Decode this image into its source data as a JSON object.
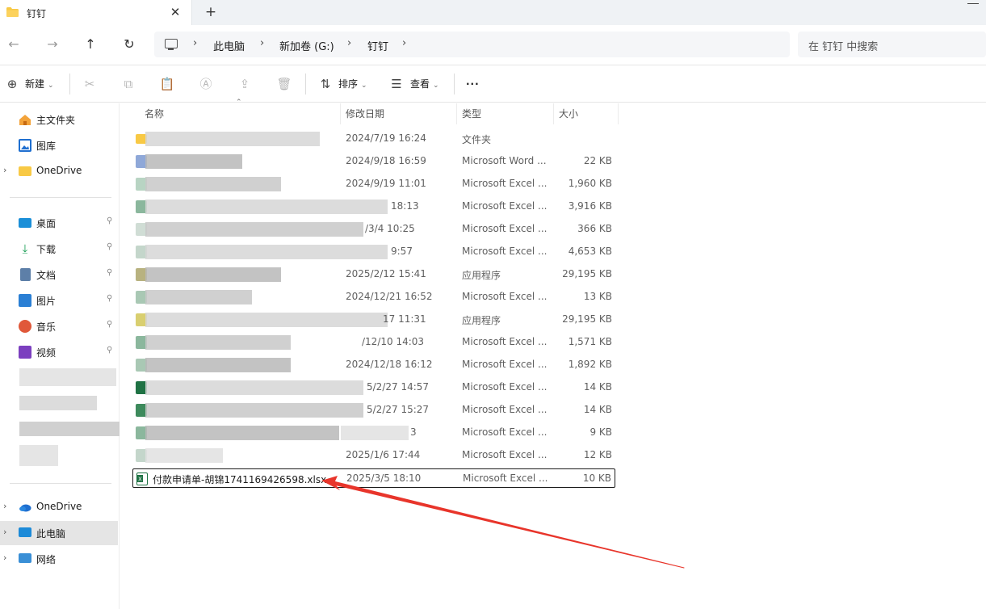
{
  "window": {
    "tab_title": "钉钉",
    "close_glyph": "✕",
    "new_tab_glyph": "+"
  },
  "nav": {
    "back_glyph": "←",
    "forward_glyph": "→",
    "up_glyph": "↑",
    "refresh_glyph": "↻",
    "breadcrumb": [
      "此电脑",
      "新加卷 (G:)",
      "钉钉"
    ],
    "chevron": "›",
    "search_placeholder": "在 钉钉 中搜索"
  },
  "toolbar": {
    "new_label": "新建",
    "sort_label": "排序",
    "view_label": "查看",
    "more_glyph": "···"
  },
  "sidebar": {
    "quick": [
      {
        "label": "主文件夹",
        "icon": "home-icon"
      },
      {
        "label": "图库",
        "icon": "gallery-icon"
      },
      {
        "label": "OneDrive",
        "icon": "folder-icon",
        "expandable": true
      }
    ],
    "pinned": [
      {
        "label": "桌面",
        "icon": "desktop-icon"
      },
      {
        "label": "下载",
        "icon": "download-icon"
      },
      {
        "label": "文档",
        "icon": "document-icon"
      },
      {
        "label": "图片",
        "icon": "pictures-icon"
      },
      {
        "label": "音乐",
        "icon": "music-icon"
      },
      {
        "label": "视频",
        "icon": "video-icon"
      }
    ],
    "bottom": [
      {
        "label": "OneDrive",
        "icon": "cloud-icon"
      },
      {
        "label": "此电脑",
        "icon": "computer-icon",
        "selected": true
      },
      {
        "label": "网络",
        "icon": "network-icon"
      }
    ],
    "pin_glyph": "📌"
  },
  "list": {
    "headers": {
      "name": "名称",
      "modified": "修改日期",
      "type": "类型",
      "size": "大小"
    },
    "rows": [
      {
        "name": "",
        "date": "2024/7/19 16:24",
        "type": "文件夹",
        "size": "",
        "kind": "folder"
      },
      {
        "name": "",
        "date": "2024/9/18 16:59",
        "type": "Microsoft Word ...",
        "size": "22 KB",
        "kind": "word"
      },
      {
        "name": "",
        "date": "2024/9/19 11:01",
        "type": "Microsoft Excel ...",
        "size": "1,960 KB",
        "kind": "excel"
      },
      {
        "name": "",
        "date": "18:13",
        "type": "Microsoft Excel ...",
        "size": "3,916 KB",
        "kind": "excel"
      },
      {
        "name": "",
        "date": "/3/4 10:25",
        "type": "Microsoft Excel ...",
        "size": "366 KB",
        "kind": "excel"
      },
      {
        "name": "",
        "date": "9:57",
        "type": "Microsoft Excel ...",
        "size": "4,653 KB",
        "kind": "excel"
      },
      {
        "name": "",
        "date": "2025/2/12 15:41",
        "type": "应用程序",
        "size": "29,195 KB",
        "kind": "app"
      },
      {
        "name": "",
        "date": "2024/12/21 16:52",
        "type": "Microsoft Excel ...",
        "size": "13 KB",
        "kind": "excel"
      },
      {
        "name": "",
        "date": "17 11:31",
        "type": "应用程序",
        "size": "29,195 KB",
        "kind": "app"
      },
      {
        "name": "",
        "date": "/12/10 14:03",
        "type": "Microsoft Excel ...",
        "size": "1,571 KB",
        "kind": "excel"
      },
      {
        "name": "",
        "date": "2024/12/18 16:12",
        "type": "Microsoft Excel ...",
        "size": "1,892 KB",
        "kind": "excel"
      },
      {
        "name": "",
        "date": "5/2/27 14:57",
        "type": "Microsoft Excel ...",
        "size": "14 KB",
        "kind": "excel"
      },
      {
        "name": "",
        "date": "5/2/27 15:27",
        "type": "Microsoft Excel ...",
        "size": "14 KB",
        "kind": "excel"
      },
      {
        "name": "",
        "date": "3",
        "type": "Microsoft Excel ...",
        "size": "9 KB",
        "kind": "excel"
      },
      {
        "name": "",
        "date": "2025/1/6 17:44",
        "type": "Microsoft Excel ...",
        "size": "12 KB",
        "kind": "excel"
      },
      {
        "name": "付款申请单-胡锦1741169426598.xlsx",
        "date": "2025/3/5 18:10",
        "type": "Microsoft Excel ...",
        "size": "10 KB",
        "kind": "excel",
        "selected": true
      }
    ]
  },
  "colors": {
    "folder": "#f8c945",
    "excel": "#1f7244",
    "word": "#2b5797",
    "arrow": "#e8352b",
    "selection_bg": "#e5e5e5"
  }
}
